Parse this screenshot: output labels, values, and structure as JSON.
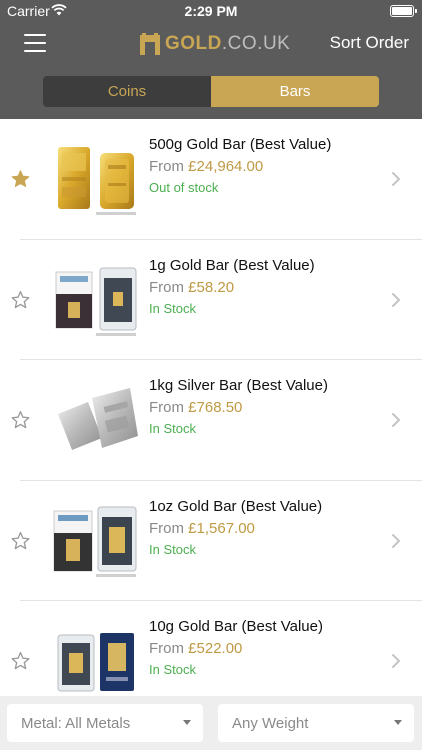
{
  "status_bar": {
    "carrier": "Carrier",
    "time": "2:29 PM",
    "wifi_icon": "wifi-icon",
    "battery_icon": "battery-icon"
  },
  "header": {
    "menu_icon": "hamburger-menu-icon",
    "logo": {
      "gold": "GOLD",
      "tld": ".CO.UK"
    },
    "sort_label": "Sort Order"
  },
  "tabs": {
    "coins": "Coins",
    "bars": "Bars",
    "selected": "Bars"
  },
  "colors": {
    "header_bg": "#5b5b5b",
    "accent": "#c9a654",
    "price": "#bf9a45",
    "in_stock": "#4caf50",
    "tab_unselected_bg": "#3d3d3d"
  },
  "products": [
    {
      "title": "500g Gold Bar (Best Value)",
      "from": "From",
      "price": "£24,964.00",
      "stock": "Out of stock",
      "favorite": true,
      "image": "gold-bar-image"
    },
    {
      "title": "1g Gold Bar (Best Value)",
      "from": "From",
      "price": "£58.20",
      "stock": "In Stock",
      "favorite": false,
      "image": "gold-bar-card-image"
    },
    {
      "title": "1kg Silver Bar (Best Value)",
      "from": "From",
      "price": "£768.50",
      "stock": "In Stock",
      "favorite": false,
      "image": "silver-bar-image"
    },
    {
      "title": "1oz Gold Bar (Best Value)",
      "from": "From",
      "price": "£1,567.00",
      "stock": "In Stock",
      "favorite": false,
      "image": "gold-bar-card-image"
    },
    {
      "title": "10g Gold Bar (Best Value)",
      "from": "From",
      "price": "£522.00",
      "stock": "In Stock",
      "favorite": false,
      "image": "gold-bar-card-image"
    }
  ],
  "filters": {
    "metal": "Metal: All Metals",
    "weight": "Any Weight"
  }
}
